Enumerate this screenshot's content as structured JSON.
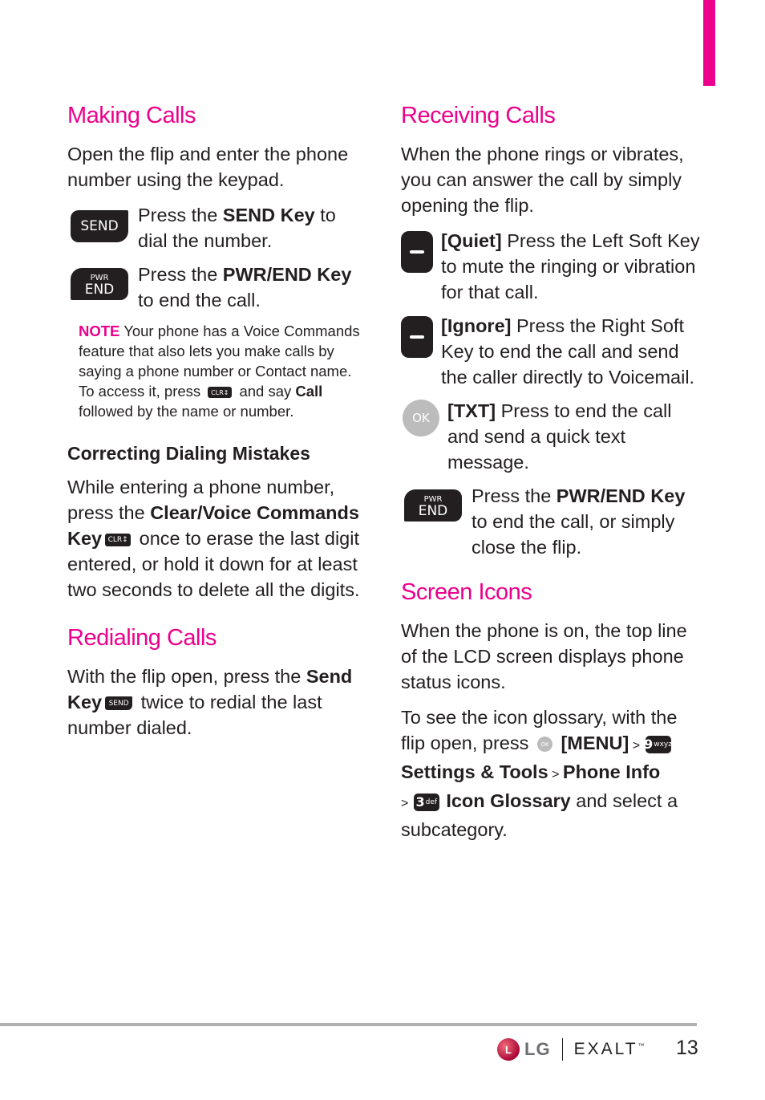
{
  "colors": {
    "accent": "#ec008c",
    "text": "#231f20",
    "key_bg": "#231f20",
    "ok_bg": "#bdbcbc",
    "rule": "#b1b1b1"
  },
  "left": {
    "making_calls": {
      "title": "Making Calls",
      "intro": "Open the flip and enter the phone number using the keypad.",
      "send_row": {
        "icon_label": "SEND",
        "t1": "Press the ",
        "b1": "SEND Key",
        "t2": " to dial the number."
      },
      "end_row": {
        "icon_small": "PWR",
        "icon_large": "END",
        "t1": "Press the ",
        "b1": "PWR/END Key",
        "t2": " to end the call."
      },
      "note": {
        "label": "NOTE",
        "t1": " Your phone has a Voice Commands feature that also lets you make calls by saying a phone number or Contact name. To access it, press ",
        "key": "CLR↕",
        "t2": " and say ",
        "b1": "Call",
        "t3": " followed by the name or number."
      }
    },
    "correcting": {
      "title": "Correcting Dialing Mistakes",
      "t1": "While entering a phone number, press the ",
      "b1": "Clear/Voice Commands Key",
      "key": "CLR↕",
      "t2": " once to erase the last digit entered, or hold it down for at least two seconds to delete all the digits."
    },
    "redialing": {
      "title": "Redialing Calls",
      "t1": "With the flip open, press the ",
      "b1": "Send Key",
      "key": "SEND",
      "t2": " twice to redial the last number dialed."
    }
  },
  "right": {
    "receiving": {
      "title": "Receiving Calls",
      "intro": "When the phone rings or vibrates, you can answer the call by simply opening the flip.",
      "quiet_row": {
        "b1": "[Quiet]",
        "t1": " Press the Left Soft Key to mute the ringing or vibration for that call."
      },
      "ignore_row": {
        "b1": "[Ignore]",
        "t1": " Press the Right Soft Key to end the call and send the caller directly to Voicemail."
      },
      "txt_row": {
        "icon_label": "OK",
        "b1": "[TXT]",
        "t1": " Press to end the call and send a quick text message."
      },
      "end_row": {
        "icon_small": "PWR",
        "icon_large": "END",
        "t1": "Press the ",
        "b1": "PWR/END Key",
        "t2": " to end the call, or simply close the flip."
      }
    },
    "screen_icons": {
      "title": "Screen Icons",
      "p1": "When the phone is on, the top line of the LCD screen displays phone status icons.",
      "p2": {
        "t1": "To see the icon glossary, with the flip open, press ",
        "ok_key": "OK",
        "b1": "[MENU]",
        "gt1": " > ",
        "key9_digit": "9",
        "key9_letters": "wxyz",
        "b2": "Settings & Tools",
        "gt2": " > ",
        "b3": "Phone Info",
        "gt3": "> ",
        "key3_digit": "3",
        "key3_letters": "def",
        "b4": "Icon Glossary",
        "t2": " and select a subcategory."
      }
    }
  },
  "footer": {
    "logo_mark": "L",
    "brand": "LG",
    "product": "EXALT",
    "trademark": "™",
    "page_number": "13"
  }
}
